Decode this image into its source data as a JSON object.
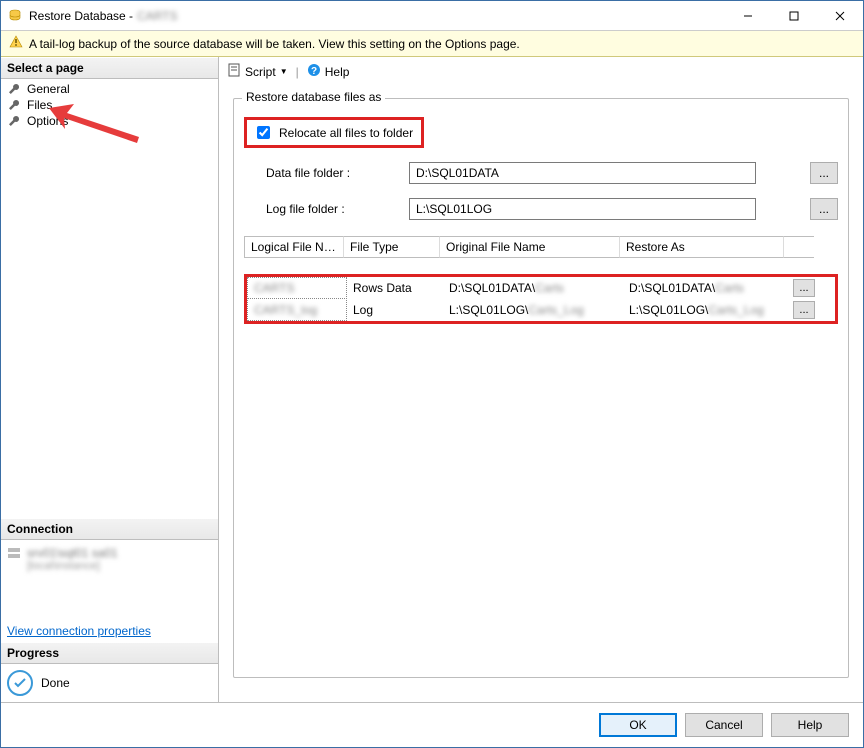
{
  "window": {
    "title": "Restore Database -",
    "title_extra": "CARTS"
  },
  "warning": "A tail-log backup of the source database will be taken. View this setting on the Options page.",
  "sidebar": {
    "header": "Select a page",
    "items": [
      {
        "label": "General"
      },
      {
        "label": "Files"
      },
      {
        "label": "Options"
      }
    ]
  },
  "connection": {
    "header": "Connection",
    "server": "srv01\\sql01 sa01",
    "detail": "[local\\instance]",
    "link": "View connection properties"
  },
  "progress": {
    "header": "Progress",
    "status": "Done"
  },
  "toolbar": {
    "script": "Script",
    "help": "Help"
  },
  "group": {
    "legend": "Restore database files as",
    "relocate_label": "Relocate all files to folder",
    "data_folder_label": "Data file folder :",
    "data_folder_value": "D:\\SQL01DATA",
    "log_folder_label": "Log file folder :",
    "log_folder_value": "L:\\SQL01LOG",
    "browse": "..."
  },
  "table": {
    "headers": {
      "logical": "Logical File Name",
      "type": "File Type",
      "original": "Original File Name",
      "restore": "Restore As"
    },
    "rows": [
      {
        "logical": "CARTS",
        "type": "Rows Data",
        "original_prefix": "D:\\SQL01DATA\\",
        "original_suffix": "Carts",
        "restore_prefix": "D:\\SQL01DATA\\",
        "restore_suffix": "Carts"
      },
      {
        "logical": "CARTS_log",
        "type": "Log",
        "original_prefix": "L:\\SQL01LOG\\",
        "original_suffix": "Carts_Log",
        "restore_prefix": "L:\\SQL01LOG\\",
        "restore_suffix": "Carts_Log"
      }
    ]
  },
  "footer": {
    "ok": "OK",
    "cancel": "Cancel",
    "help": "Help"
  }
}
